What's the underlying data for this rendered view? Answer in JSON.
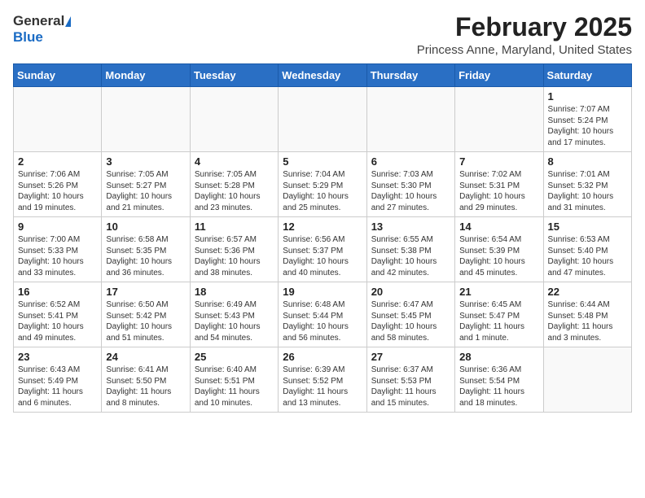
{
  "header": {
    "logo_general": "General",
    "logo_blue": "Blue",
    "month_title": "February 2025",
    "location": "Princess Anne, Maryland, United States"
  },
  "calendar": {
    "days_of_week": [
      "Sunday",
      "Monday",
      "Tuesday",
      "Wednesday",
      "Thursday",
      "Friday",
      "Saturday"
    ],
    "weeks": [
      [
        {
          "day": "",
          "info": ""
        },
        {
          "day": "",
          "info": ""
        },
        {
          "day": "",
          "info": ""
        },
        {
          "day": "",
          "info": ""
        },
        {
          "day": "",
          "info": ""
        },
        {
          "day": "",
          "info": ""
        },
        {
          "day": "1",
          "info": "Sunrise: 7:07 AM\nSunset: 5:24 PM\nDaylight: 10 hours and 17 minutes."
        }
      ],
      [
        {
          "day": "2",
          "info": "Sunrise: 7:06 AM\nSunset: 5:26 PM\nDaylight: 10 hours and 19 minutes."
        },
        {
          "day": "3",
          "info": "Sunrise: 7:05 AM\nSunset: 5:27 PM\nDaylight: 10 hours and 21 minutes."
        },
        {
          "day": "4",
          "info": "Sunrise: 7:05 AM\nSunset: 5:28 PM\nDaylight: 10 hours and 23 minutes."
        },
        {
          "day": "5",
          "info": "Sunrise: 7:04 AM\nSunset: 5:29 PM\nDaylight: 10 hours and 25 minutes."
        },
        {
          "day": "6",
          "info": "Sunrise: 7:03 AM\nSunset: 5:30 PM\nDaylight: 10 hours and 27 minutes."
        },
        {
          "day": "7",
          "info": "Sunrise: 7:02 AM\nSunset: 5:31 PM\nDaylight: 10 hours and 29 minutes."
        },
        {
          "day": "8",
          "info": "Sunrise: 7:01 AM\nSunset: 5:32 PM\nDaylight: 10 hours and 31 minutes."
        }
      ],
      [
        {
          "day": "9",
          "info": "Sunrise: 7:00 AM\nSunset: 5:33 PM\nDaylight: 10 hours and 33 minutes."
        },
        {
          "day": "10",
          "info": "Sunrise: 6:58 AM\nSunset: 5:35 PM\nDaylight: 10 hours and 36 minutes."
        },
        {
          "day": "11",
          "info": "Sunrise: 6:57 AM\nSunset: 5:36 PM\nDaylight: 10 hours and 38 minutes."
        },
        {
          "day": "12",
          "info": "Sunrise: 6:56 AM\nSunset: 5:37 PM\nDaylight: 10 hours and 40 minutes."
        },
        {
          "day": "13",
          "info": "Sunrise: 6:55 AM\nSunset: 5:38 PM\nDaylight: 10 hours and 42 minutes."
        },
        {
          "day": "14",
          "info": "Sunrise: 6:54 AM\nSunset: 5:39 PM\nDaylight: 10 hours and 45 minutes."
        },
        {
          "day": "15",
          "info": "Sunrise: 6:53 AM\nSunset: 5:40 PM\nDaylight: 10 hours and 47 minutes."
        }
      ],
      [
        {
          "day": "16",
          "info": "Sunrise: 6:52 AM\nSunset: 5:41 PM\nDaylight: 10 hours and 49 minutes."
        },
        {
          "day": "17",
          "info": "Sunrise: 6:50 AM\nSunset: 5:42 PM\nDaylight: 10 hours and 51 minutes."
        },
        {
          "day": "18",
          "info": "Sunrise: 6:49 AM\nSunset: 5:43 PM\nDaylight: 10 hours and 54 minutes."
        },
        {
          "day": "19",
          "info": "Sunrise: 6:48 AM\nSunset: 5:44 PM\nDaylight: 10 hours and 56 minutes."
        },
        {
          "day": "20",
          "info": "Sunrise: 6:47 AM\nSunset: 5:45 PM\nDaylight: 10 hours and 58 minutes."
        },
        {
          "day": "21",
          "info": "Sunrise: 6:45 AM\nSunset: 5:47 PM\nDaylight: 11 hours and 1 minute."
        },
        {
          "day": "22",
          "info": "Sunrise: 6:44 AM\nSunset: 5:48 PM\nDaylight: 11 hours and 3 minutes."
        }
      ],
      [
        {
          "day": "23",
          "info": "Sunrise: 6:43 AM\nSunset: 5:49 PM\nDaylight: 11 hours and 6 minutes."
        },
        {
          "day": "24",
          "info": "Sunrise: 6:41 AM\nSunset: 5:50 PM\nDaylight: 11 hours and 8 minutes."
        },
        {
          "day": "25",
          "info": "Sunrise: 6:40 AM\nSunset: 5:51 PM\nDaylight: 11 hours and 10 minutes."
        },
        {
          "day": "26",
          "info": "Sunrise: 6:39 AM\nSunset: 5:52 PM\nDaylight: 11 hours and 13 minutes."
        },
        {
          "day": "27",
          "info": "Sunrise: 6:37 AM\nSunset: 5:53 PM\nDaylight: 11 hours and 15 minutes."
        },
        {
          "day": "28",
          "info": "Sunrise: 6:36 AM\nSunset: 5:54 PM\nDaylight: 11 hours and 18 minutes."
        },
        {
          "day": "",
          "info": ""
        }
      ]
    ]
  }
}
